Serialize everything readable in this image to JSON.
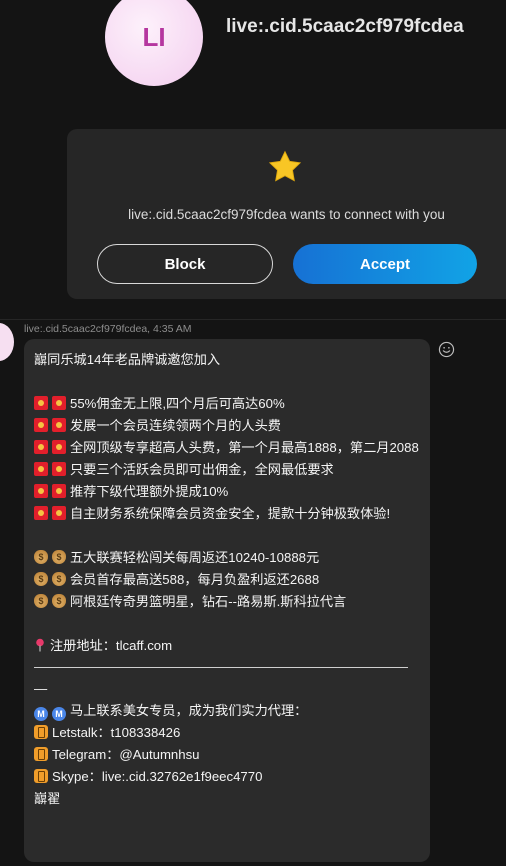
{
  "contact": {
    "initials": "LI",
    "name": "live:.cid.5caac2cf979fcdea"
  },
  "request": {
    "icon": "star-icon",
    "text": "live:.cid.5caac2cf979fcdea wants to connect with you",
    "block_label": "Block",
    "accept_label": "Accept"
  },
  "message": {
    "meta": "live:.cid.5caac2cf979fcdea, 4:35 AM",
    "lines": {
      "l0": "巐同乐城14年老品牌诚邀您加入",
      "l1": "55%佣金无上限,四个月后可高达60%",
      "l2": "发展一个会员连续领两个月的人头费",
      "l3": "全网顶级专享超高人头费，第一个月最高1888，第二月2088",
      "l4": "只要三个活跃会员即可出佣金，全网最低要求",
      "l5": "推荐下级代理额外提成10%",
      "l6": "自主财务系统保障会员资金安全，提款十分钟极致体验!",
      "l7": "五大联赛轻松闯关每周返还10240-10888元",
      "l8": "会员首存最高送588，每月负盈利返还2688",
      "l9": "阿根廷传奇男篮明星，钻石--路易斯.斯科拉代言",
      "l10": "注册地址：tlcaff.com",
      "l11": "—",
      "l12": "马上联系美女专员，成为我们实力代理：",
      "l13": "Letstalk：t108338426",
      "l14": "Telegram：@Autumnhsu",
      "l15": "Skype：live:.cid.32762e1f9eec4770",
      "l16": "巐翟"
    }
  },
  "icons": {
    "envelope": "red-envelope-icon",
    "money": "money-bag-icon",
    "pin": "pushpin-icon",
    "m": "m-circle-icon",
    "phone": "mobile-phone-icon",
    "react": "smiley-icon"
  }
}
